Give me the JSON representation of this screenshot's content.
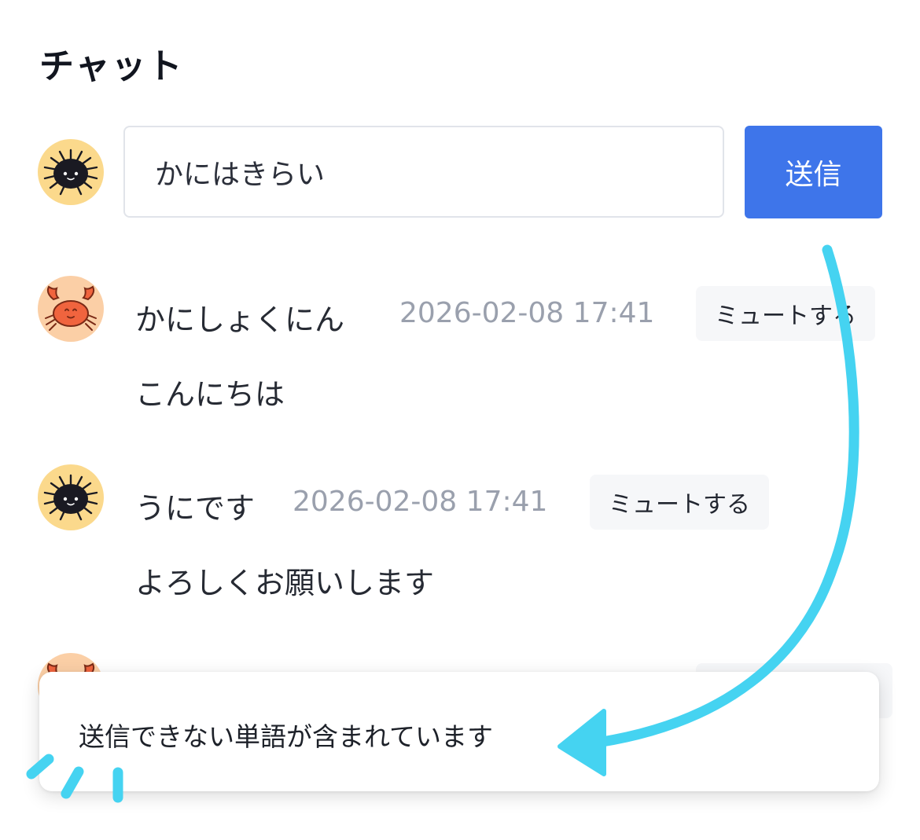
{
  "header": {
    "title": "チャット"
  },
  "composer": {
    "input_value": "かにはきらい",
    "send_label": "送信"
  },
  "messages": [
    {
      "author": "かにしょくにん",
      "avatar": "crab-avatar",
      "timestamp": "2026-02-08 17:41",
      "mute_label": "ミュートする",
      "text": "こんにちは"
    },
    {
      "author": "うにです",
      "avatar": "sea-urchin-avatar",
      "timestamp": "2026-02-08 17:41",
      "mute_label": "ミュートする",
      "text": "よろしくお願いします"
    }
  ],
  "toast": {
    "message": "送信できない単語が含まれています"
  },
  "colors": {
    "accent": "#3e75ea",
    "annotation": "#45d3f1",
    "urchin_bg": "#fbd98c",
    "crab_bg": "#fbcfa6"
  }
}
